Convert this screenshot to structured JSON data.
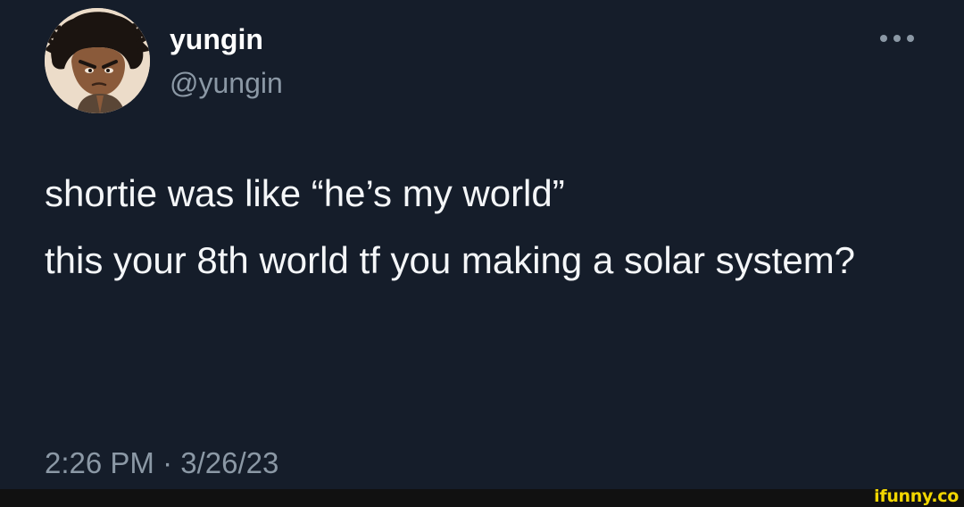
{
  "tweet": {
    "author": {
      "display_name": "yungin",
      "handle": "@yungin",
      "avatar_icon": "cartoon-avatar-icon"
    },
    "more_icon": "more-options-icon",
    "text_paragraphs": [
      "shortie was like “he’s my world”",
      "this your 8th world tf you making a solar system?"
    ],
    "timestamp": {
      "time": "2:26 PM",
      "separator": "·",
      "date": "3/26/23"
    }
  },
  "watermark": {
    "text": "ifunny.co",
    "color": "#f2d600"
  },
  "colors": {
    "background": "#151d2a",
    "primary_text": "#ffffff",
    "secondary_text": "#8b98a5"
  }
}
